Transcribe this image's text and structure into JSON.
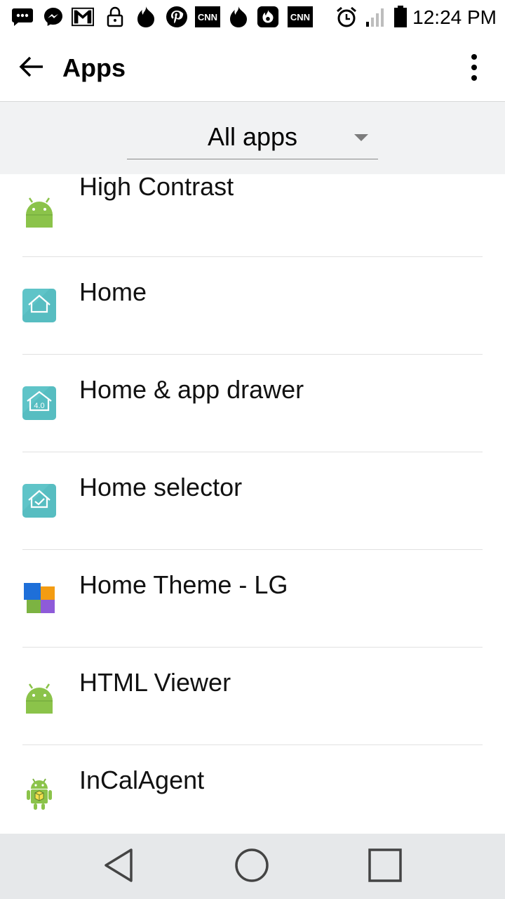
{
  "status_bar": {
    "time": "12:24 PM",
    "icons": [
      "sms-icon",
      "messenger-icon",
      "gmail-icon",
      "lock-icon",
      "tinder-icon",
      "pinterest-icon",
      "cnn-icon",
      "tinder-icon",
      "hotspot-flame-icon",
      "cnn-icon",
      "alarm-icon",
      "signal-icon",
      "battery-icon"
    ],
    "cnn_text": "CNN"
  },
  "app_bar": {
    "title": "Apps",
    "back_icon": "arrow-back-icon",
    "menu_icon": "more-vert-icon"
  },
  "filter": {
    "selected": "All apps"
  },
  "apps": [
    {
      "label": "High Contrast",
      "icon": "android-icon"
    },
    {
      "label": "Home",
      "icon": "home-icon"
    },
    {
      "label": "Home & app drawer",
      "icon": "home-4-0-icon"
    },
    {
      "label": "Home selector",
      "icon": "home-check-icon"
    },
    {
      "label": "Home Theme - LG",
      "icon": "theme-tiles-icon"
    },
    {
      "label": "HTML Viewer",
      "icon": "android-icon"
    },
    {
      "label": "InCalAgent",
      "icon": "android-package-icon"
    }
  ],
  "home_icon_badge_text": "4.0",
  "nav_bar": {
    "icons": [
      "back-triangle-icon",
      "home-circle-icon",
      "recents-square-icon"
    ]
  },
  "colors": {
    "accent_teal": "#5fc4c8",
    "android_green": "#8bc34a",
    "filter_bg": "#f1f2f3",
    "nav_bg": "#e6e8ea"
  }
}
